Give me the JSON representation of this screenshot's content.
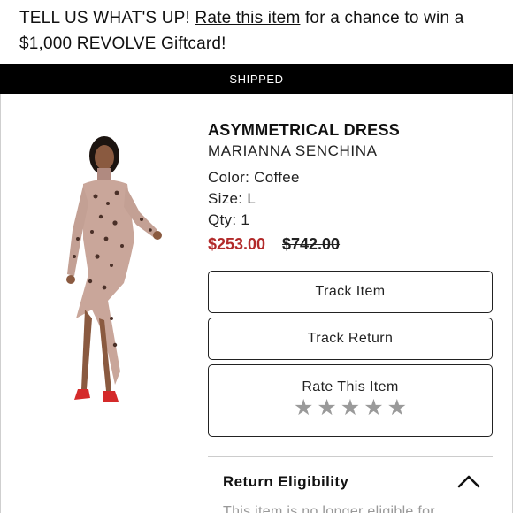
{
  "promo": {
    "prefix": "TELL US WHAT'S UP! ",
    "link": "Rate this item",
    "suffix_line1": " for a chance to win a",
    "line2": "$1,000 REVOLVE Giftcard!"
  },
  "status": {
    "label": "SHIPPED"
  },
  "product": {
    "title": "ASYMMETRICAL DRESS",
    "brand": "MARIANNA SENCHINA",
    "color": "Color: Coffee",
    "size": "Size: L",
    "qty": "Qty: 1",
    "sale_price": "$253.00",
    "original_price": "$742.00"
  },
  "actions": {
    "track_item": "Track Item",
    "track_return": "Track Return",
    "rate_item": "Rate This Item",
    "stars_total": 5,
    "stars_selected": 0,
    "star_color": "#9a9a9a"
  },
  "return_section": {
    "header": "Return Eligibility",
    "partial_text": "This item is no longer eligible for",
    "chevron_icon": "chevron-up-icon"
  },
  "colors": {
    "sale_price": "#b22a2a",
    "status_bar_bg": "#000000"
  }
}
